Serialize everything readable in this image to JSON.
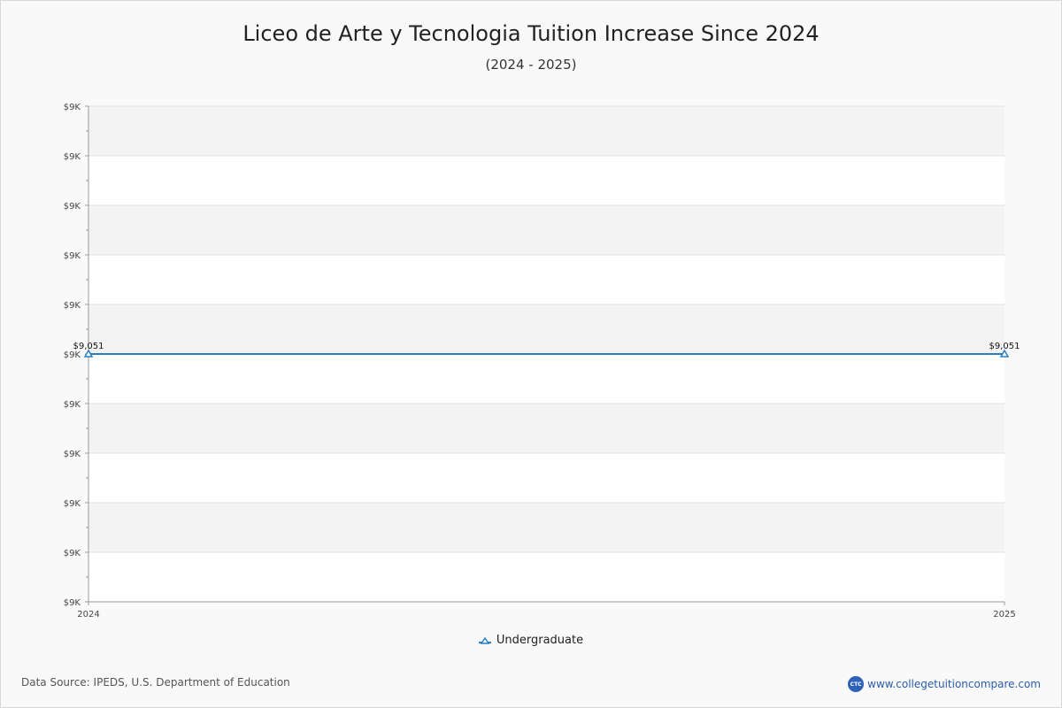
{
  "colors": {
    "series": "#2a7fc0",
    "band": "#f3f3f3",
    "plot_bg": "#ffffff",
    "axis": "#999999"
  },
  "chart_data": {
    "type": "line",
    "title": "Liceo de Arte y Tecnologia Tuition Increase Since 2024",
    "subtitle": "(2024 - 2025)",
    "x": [
      "2024",
      "2025"
    ],
    "series": [
      {
        "name": "Undergraduate",
        "values": [
          9051,
          9051
        ],
        "labels": [
          "$9,051",
          "$9,051"
        ],
        "marker": "triangle"
      }
    ],
    "y_ticks": [
      "$9K",
      "$9K",
      "$9K",
      "$9K",
      "$9K",
      "$9K",
      "$9K",
      "$9K",
      "$9K",
      "$9K",
      "$9K"
    ],
    "ylim": [
      9046,
      9056
    ],
    "grid": true,
    "legend": "bottom-center"
  },
  "footer": {
    "source": "Data Source: IPEDS, U.S. Department of Education",
    "brand": "www.collegetuitioncompare.com",
    "logo_text": "CTC"
  }
}
